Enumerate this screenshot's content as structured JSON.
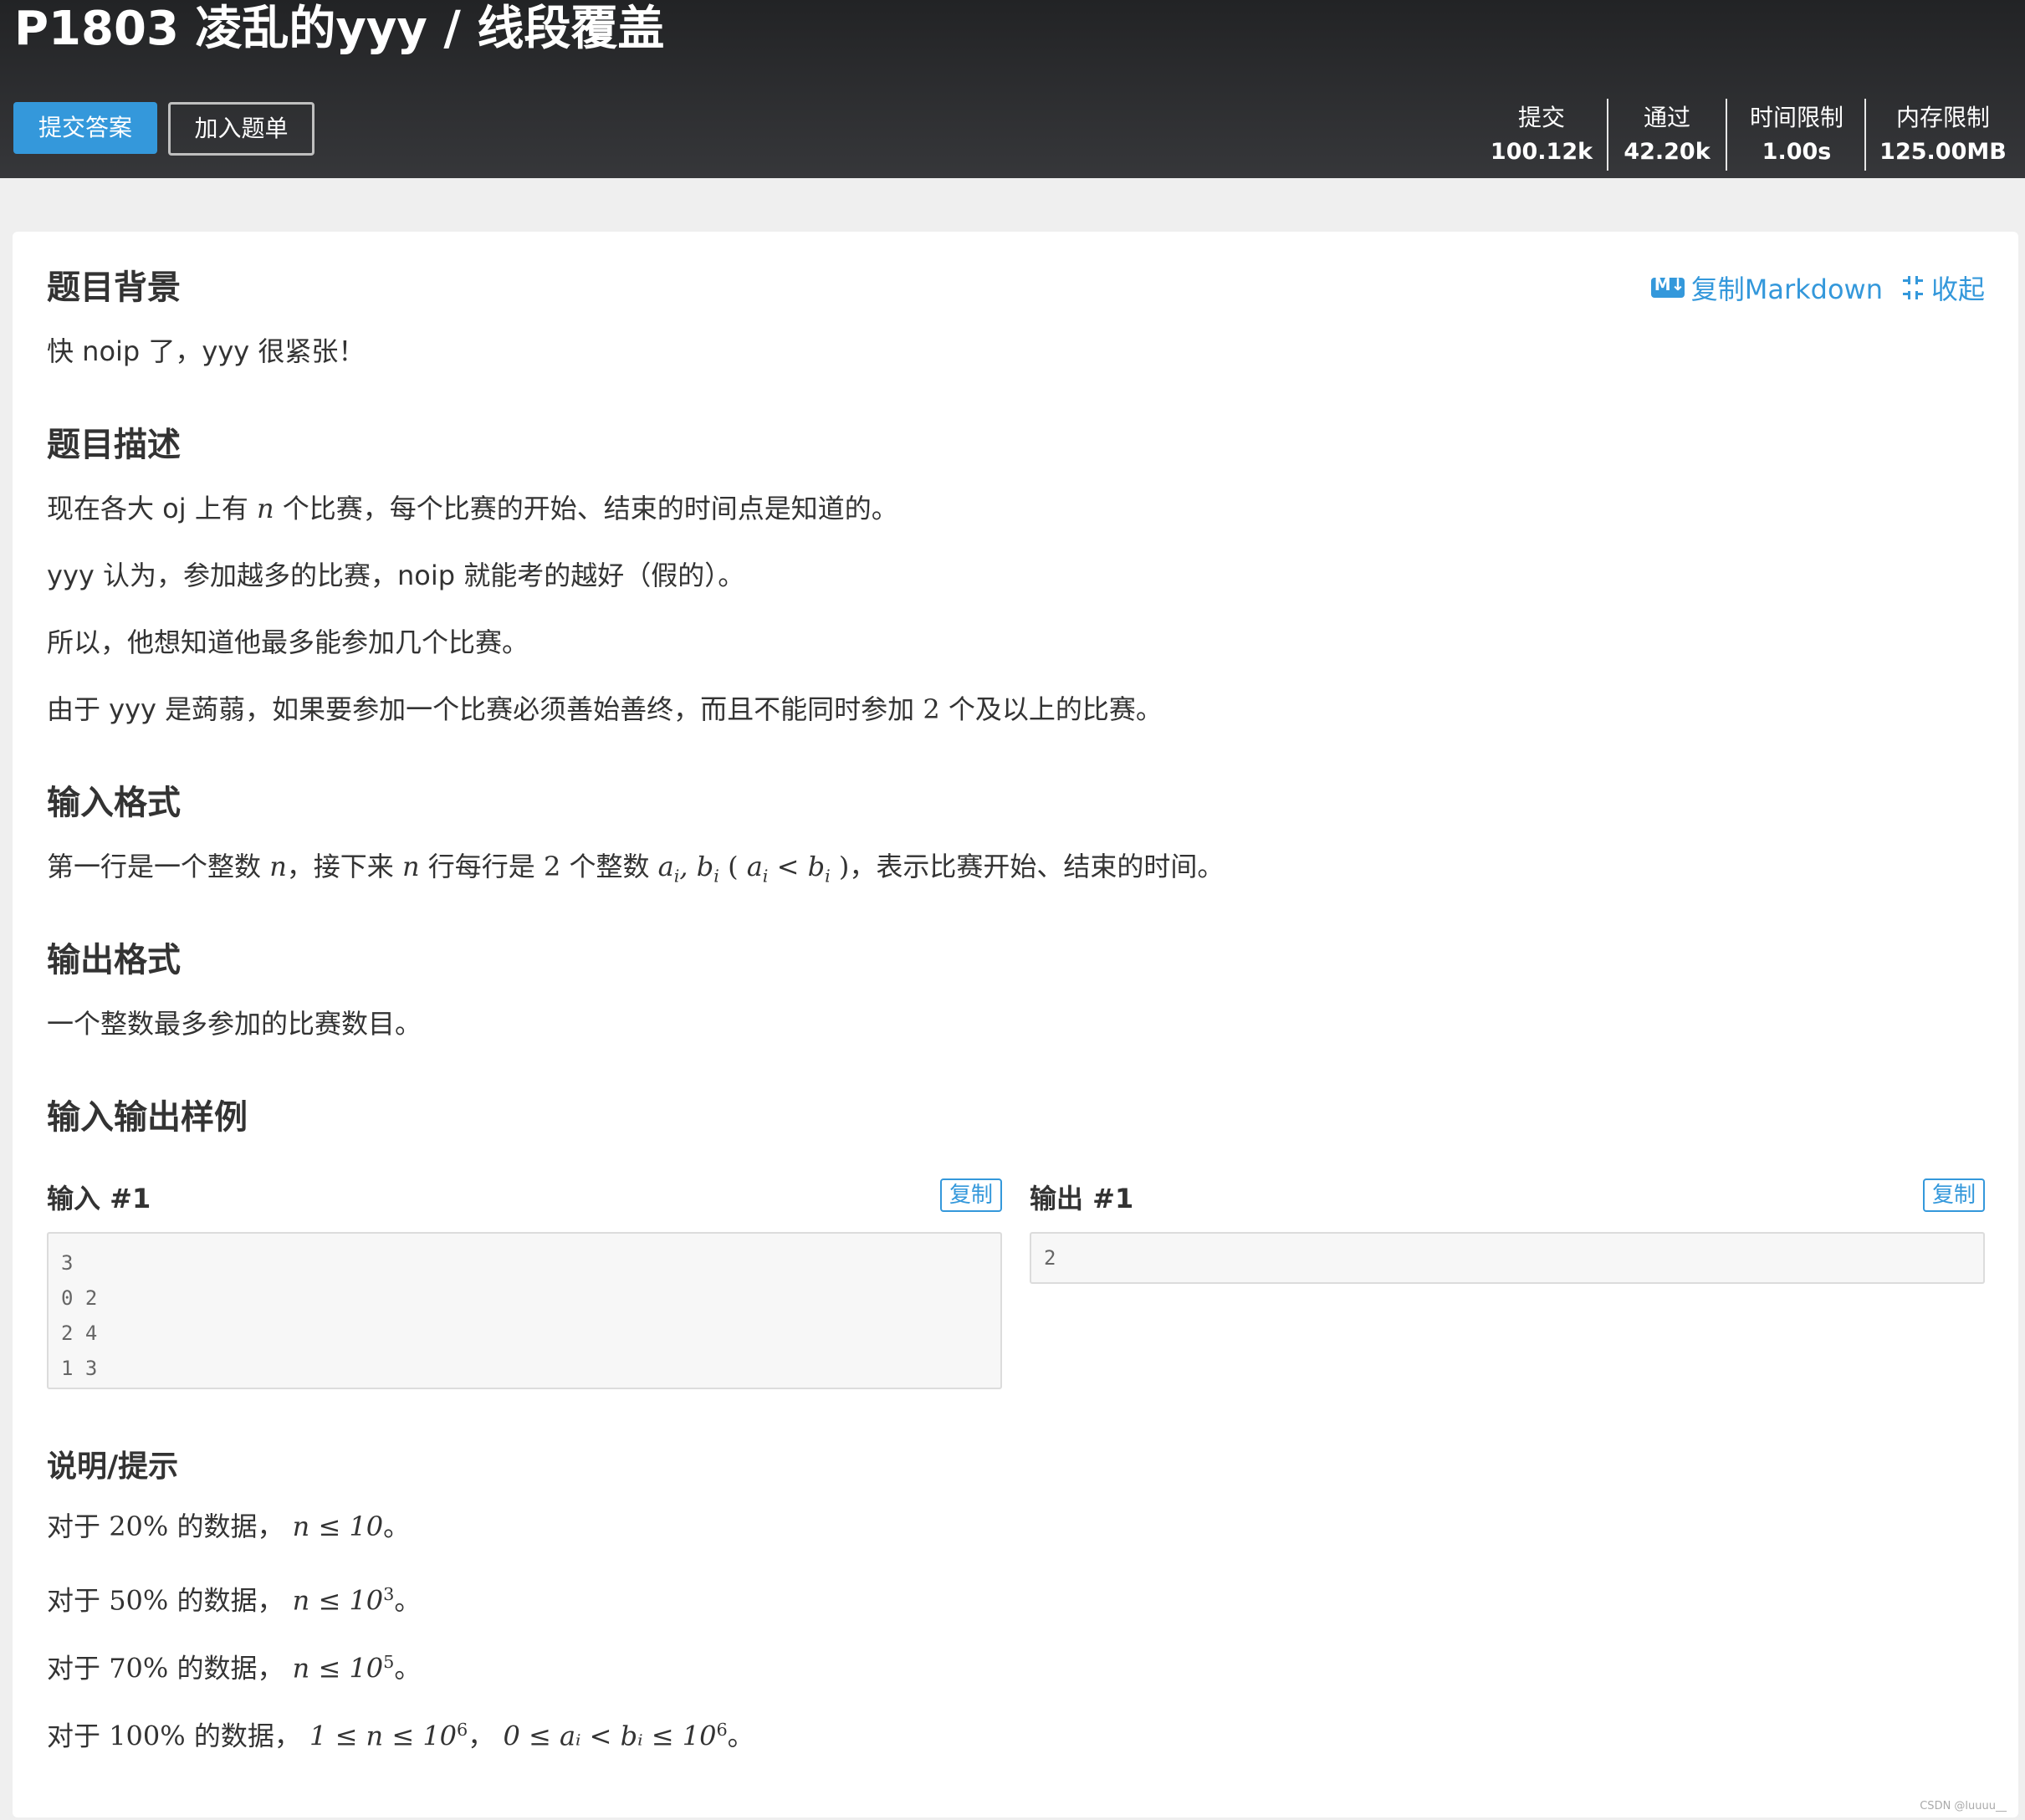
{
  "header": {
    "title": "P1803 凌乱的yyy / 线段覆盖",
    "submit_label": "提交答案",
    "add_label": "加入题单",
    "stats": [
      {
        "label": "提交",
        "value": "100.12k"
      },
      {
        "label": "通过",
        "value": "42.20k"
      },
      {
        "label": "时间限制",
        "value": "1.00s"
      },
      {
        "label": "内存限制",
        "value": "125.00MB"
      }
    ]
  },
  "toolbar": {
    "copy_markdown": "复制Markdown",
    "collapse": "收起"
  },
  "background": {
    "heading": "题目背景",
    "text": "快 noip 了，yyy 很紧张！"
  },
  "description": {
    "heading": "题目描述",
    "line1_a": "现在各大 oj 上有 ",
    "line1_var": "n",
    "line1_b": " 个比赛，每个比赛的开始、结束的时间点是知道的。",
    "line2": "yyy 认为，参加越多的比赛，noip 就能考的越好（假的）。",
    "line3": "所以，他想知道他最多能参加几个比赛。",
    "line4_a": "由于 yyy 是蒟蒻，如果要参加一个比赛必须善始善终，而且不能同时参加 ",
    "line4_num": "2",
    "line4_b": " 个及以上的比赛。"
  },
  "input_format": {
    "heading": "输入格式",
    "t1": "第一行是一个整数 ",
    "t2": "，接下来 ",
    "t3": " 行每行是 ",
    "t4": " 个整数 ",
    "t5": "，表示比赛开始、结束的时间。"
  },
  "output_format": {
    "heading": "输出格式",
    "text": "一个整数最多参加的比赛数目。"
  },
  "samples": {
    "heading": "输入输出样例",
    "input_label": "输入 #1",
    "output_label": "输出 #1",
    "copy_label": "复制",
    "input_text": "3\n0 2\n2 4\n1 3",
    "output_text": "2"
  },
  "hint": {
    "heading": "说明/提示",
    "prefix": "对于 ",
    "mid": " 的数据，",
    "rows": [
      {
        "pct": "20%",
        "cond": "n ≤ 10",
        "exp": ""
      },
      {
        "pct": "50%",
        "cond": "n ≤ 10",
        "exp": "3"
      },
      {
        "pct": "70%",
        "cond": "n ≤ 10",
        "exp": "5"
      },
      {
        "pct": "100%",
        "cond": "1 ≤ n ≤ 10",
        "exp": "6"
      }
    ],
    "row4_tail": "0 ≤ aᵢ < bᵢ ≤ 10",
    "row4_tail_exp": "6"
  },
  "watermark": "CSDN @luuuu__"
}
